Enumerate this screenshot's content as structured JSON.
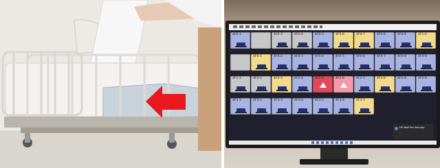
{
  "left_photo": {
    "bed_color": "#f4f2ee",
    "arrow_color": "#e8181c",
    "mat_color": "#c9d3dc"
  },
  "monitor": {
    "screen_background": "#f3f3f3",
    "empty_area_color": "#1f1f2e",
    "toast": {
      "title": "HP Wolf Pro Security",
      "text": "..."
    },
    "tiles": [
      [
        {
          "label": "4F0-1",
          "color": "#a9b3e0",
          "icon": "bed"
        },
        {
          "label": "",
          "color": "#c7c7c7",
          "icon": "none"
        },
        {
          "label": "4F0-3",
          "color": "#c7c7c7",
          "icon": "bed"
        },
        {
          "label": "4F0-4",
          "color": "#c7c7c7",
          "icon": "bed"
        },
        {
          "label": "4F0-5",
          "color": "#a9b3e0",
          "icon": "bed"
        },
        {
          "label": "4F0-6",
          "color": "#f3d98c",
          "icon": "bed"
        },
        {
          "label": "4F0-7",
          "color": "#f3d98c",
          "icon": "bed"
        },
        {
          "label": "4F0-8",
          "color": "#a9b3e0",
          "icon": "bed"
        },
        {
          "label": "4F0-9",
          "color": "#a9b3e0",
          "icon": "bed"
        },
        {
          "label": "4F1-0",
          "color": "#f3d98c",
          "icon": "bed"
        }
      ],
      [
        {
          "label": "",
          "color": "#c7c7c7",
          "icon": "none"
        },
        {
          "label": "4F0-1",
          "color": "#f3d98c",
          "icon": "bed"
        },
        {
          "label": "4F0-2",
          "color": "#a9b3e0",
          "icon": "bed"
        },
        {
          "label": "4F0-3",
          "color": "#a9b3e0",
          "icon": "bed"
        },
        {
          "label": "4F0-4",
          "color": "#a9b3e0",
          "icon": "bed"
        },
        {
          "label": "4F0-5",
          "color": "#a9b3e0",
          "icon": "bed"
        },
        {
          "label": "4F0-6",
          "color": "#a9b3e0",
          "icon": "bed"
        },
        {
          "label": "4F0-7",
          "color": "#a9b3e0",
          "icon": "bed"
        },
        {
          "label": "4F0-8",
          "color": "#a9b3e0",
          "icon": "bed"
        },
        {
          "label": "4F0-9",
          "color": "#a9b3e0",
          "icon": "bed"
        }
      ],
      [
        {
          "label": "4F2-1",
          "color": "#c7c7c7",
          "icon": "bed"
        },
        {
          "label": "4F2-2",
          "color": "#c7c7c7",
          "icon": "bed"
        },
        {
          "label": "4F2-3",
          "color": "#f3d98c",
          "icon": "bed"
        },
        {
          "label": "4F2-4",
          "color": "#a9b3e0",
          "icon": "bed"
        },
        {
          "label": "4F2-5",
          "color": "#e24a5a",
          "icon": "warning"
        },
        {
          "label": "4F2-6",
          "color": "#f49aa8",
          "icon": "warning"
        },
        {
          "label": "4F2-7",
          "color": "#a9b3e0",
          "icon": "bed"
        },
        {
          "label": "4F2-8",
          "color": "#f3d98c",
          "icon": "bed"
        },
        {
          "label": "4F2-9",
          "color": "#a9b3e0",
          "icon": "bed"
        },
        {
          "label": "4F3-0",
          "color": "#a9b3e0",
          "icon": "bed"
        }
      ],
      [
        {
          "label": "4F3-1",
          "color": "#a9b3e0",
          "icon": "bed"
        },
        {
          "label": "4F3-2",
          "color": "#a9b3e0",
          "icon": "bed"
        },
        {
          "label": "4F3-3",
          "color": "#a9b3e0",
          "icon": "bed"
        },
        {
          "label": "4F3-4",
          "color": "#a9b3e0",
          "icon": "bed"
        },
        {
          "label": "4F3-5",
          "color": "#a9b3e0",
          "icon": "bed"
        },
        {
          "label": "4F3-6",
          "color": "#a9b3e0",
          "icon": "bed"
        },
        {
          "label": "4F3-7",
          "color": "#f3d98c",
          "icon": "bed"
        },
        {
          "label": "",
          "color": "#1f1f2e",
          "icon": "none"
        },
        {
          "label": "",
          "color": "#1f1f2e",
          "icon": "none"
        },
        {
          "label": "",
          "color": "#1f1f2e",
          "icon": "none"
        }
      ]
    ]
  }
}
